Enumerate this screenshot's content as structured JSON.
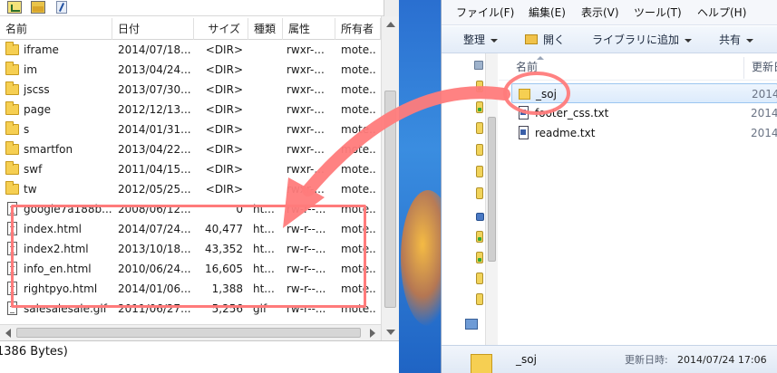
{
  "ftp": {
    "columns": [
      "名前",
      "日付",
      "サイズ",
      "種類",
      "属性",
      "所有者"
    ],
    "rows": [
      {
        "icon": "folder-icon",
        "name": "iframe",
        "date": "2014/07/18...",
        "size": "<DIR>",
        "type": "",
        "attr": "rwxr-...",
        "owner": "mote..."
      },
      {
        "icon": "folder-icon",
        "name": "im",
        "date": "2013/04/24...",
        "size": "<DIR>",
        "type": "",
        "attr": "rwxr-...",
        "owner": "mote..."
      },
      {
        "icon": "folder-icon",
        "name": "jscss",
        "date": "2013/07/30...",
        "size": "<DIR>",
        "type": "",
        "attr": "rwxr-...",
        "owner": "mote..."
      },
      {
        "icon": "folder-icon",
        "name": "page",
        "date": "2012/12/13...",
        "size": "<DIR>",
        "type": "",
        "attr": "rwxr-...",
        "owner": "mote..."
      },
      {
        "icon": "folder-icon",
        "name": "s",
        "date": "2014/01/31...",
        "size": "<DIR>",
        "type": "",
        "attr": "rwxr-...",
        "owner": "mote..."
      },
      {
        "icon": "folder-icon",
        "name": "smartfon",
        "date": "2013/04/22...",
        "size": "<DIR>",
        "type": "",
        "attr": "rwxr-...",
        "owner": "mote..."
      },
      {
        "icon": "folder-icon",
        "name": "swf",
        "date": "2011/04/15...",
        "size": "<DIR>",
        "type": "",
        "attr": "rwxr-...",
        "owner": "mote..."
      },
      {
        "icon": "folder-icon",
        "name": "tw",
        "date": "2012/05/25...",
        "size": "<DIR>",
        "type": "",
        "attr": "rwxr-...",
        "owner": "mote..."
      },
      {
        "icon": "file-icon",
        "name": "google7a188b...",
        "date": "2008/06/12...",
        "size": "0",
        "type": "ht...",
        "attr": "rw-r--...",
        "owner": "mote..."
      },
      {
        "icon": "file-icon",
        "name": "index.html",
        "date": "2014/07/24...",
        "size": "40,477",
        "type": "ht...",
        "attr": "rw-r--...",
        "owner": "mote..."
      },
      {
        "icon": "file-icon",
        "name": "index2.html",
        "date": "2013/10/18...",
        "size": "43,352",
        "type": "ht...",
        "attr": "rw-r--...",
        "owner": "mote..."
      },
      {
        "icon": "file-icon",
        "name": "info_en.html",
        "date": "2010/06/24...",
        "size": "16,605",
        "type": "ht...",
        "attr": "rw-r--...",
        "owner": "mote..."
      },
      {
        "icon": "file-icon",
        "name": "rightpyo.html",
        "date": "2014/01/06...",
        "size": "1,388",
        "type": "ht...",
        "attr": "rw-r--...",
        "owner": "mote..."
      },
      {
        "icon": "file-icon",
        "name": "salesalesale.gif",
        "date": "2011/06/27...",
        "size": "5,256",
        "type": "gif",
        "attr": "rw-r--...",
        "owner": "mote..."
      }
    ],
    "status": "1386 Bytes)"
  },
  "explorer": {
    "menu": [
      "ファイル(F)",
      "編集(E)",
      "表示(V)",
      "ツール(T)",
      "ヘルプ(H)"
    ],
    "commands": {
      "organize": "整理",
      "open": "開く",
      "library": "ライブラリに追加",
      "share": "共有"
    },
    "header": {
      "name": "名前",
      "date": "更新日"
    },
    "files": [
      {
        "icon": "folder-icon",
        "name": "_soj",
        "date": "2014"
      },
      {
        "icon": "document-icon",
        "name": "footer_css.txt",
        "date": "2014"
      },
      {
        "icon": "document-icon",
        "name": "readme.txt",
        "date": "2014"
      }
    ],
    "details": {
      "name": "_soj",
      "label": "更新日時:",
      "value": "2014/07/24 17:06"
    }
  },
  "annotation_color": "#ff7b7b"
}
